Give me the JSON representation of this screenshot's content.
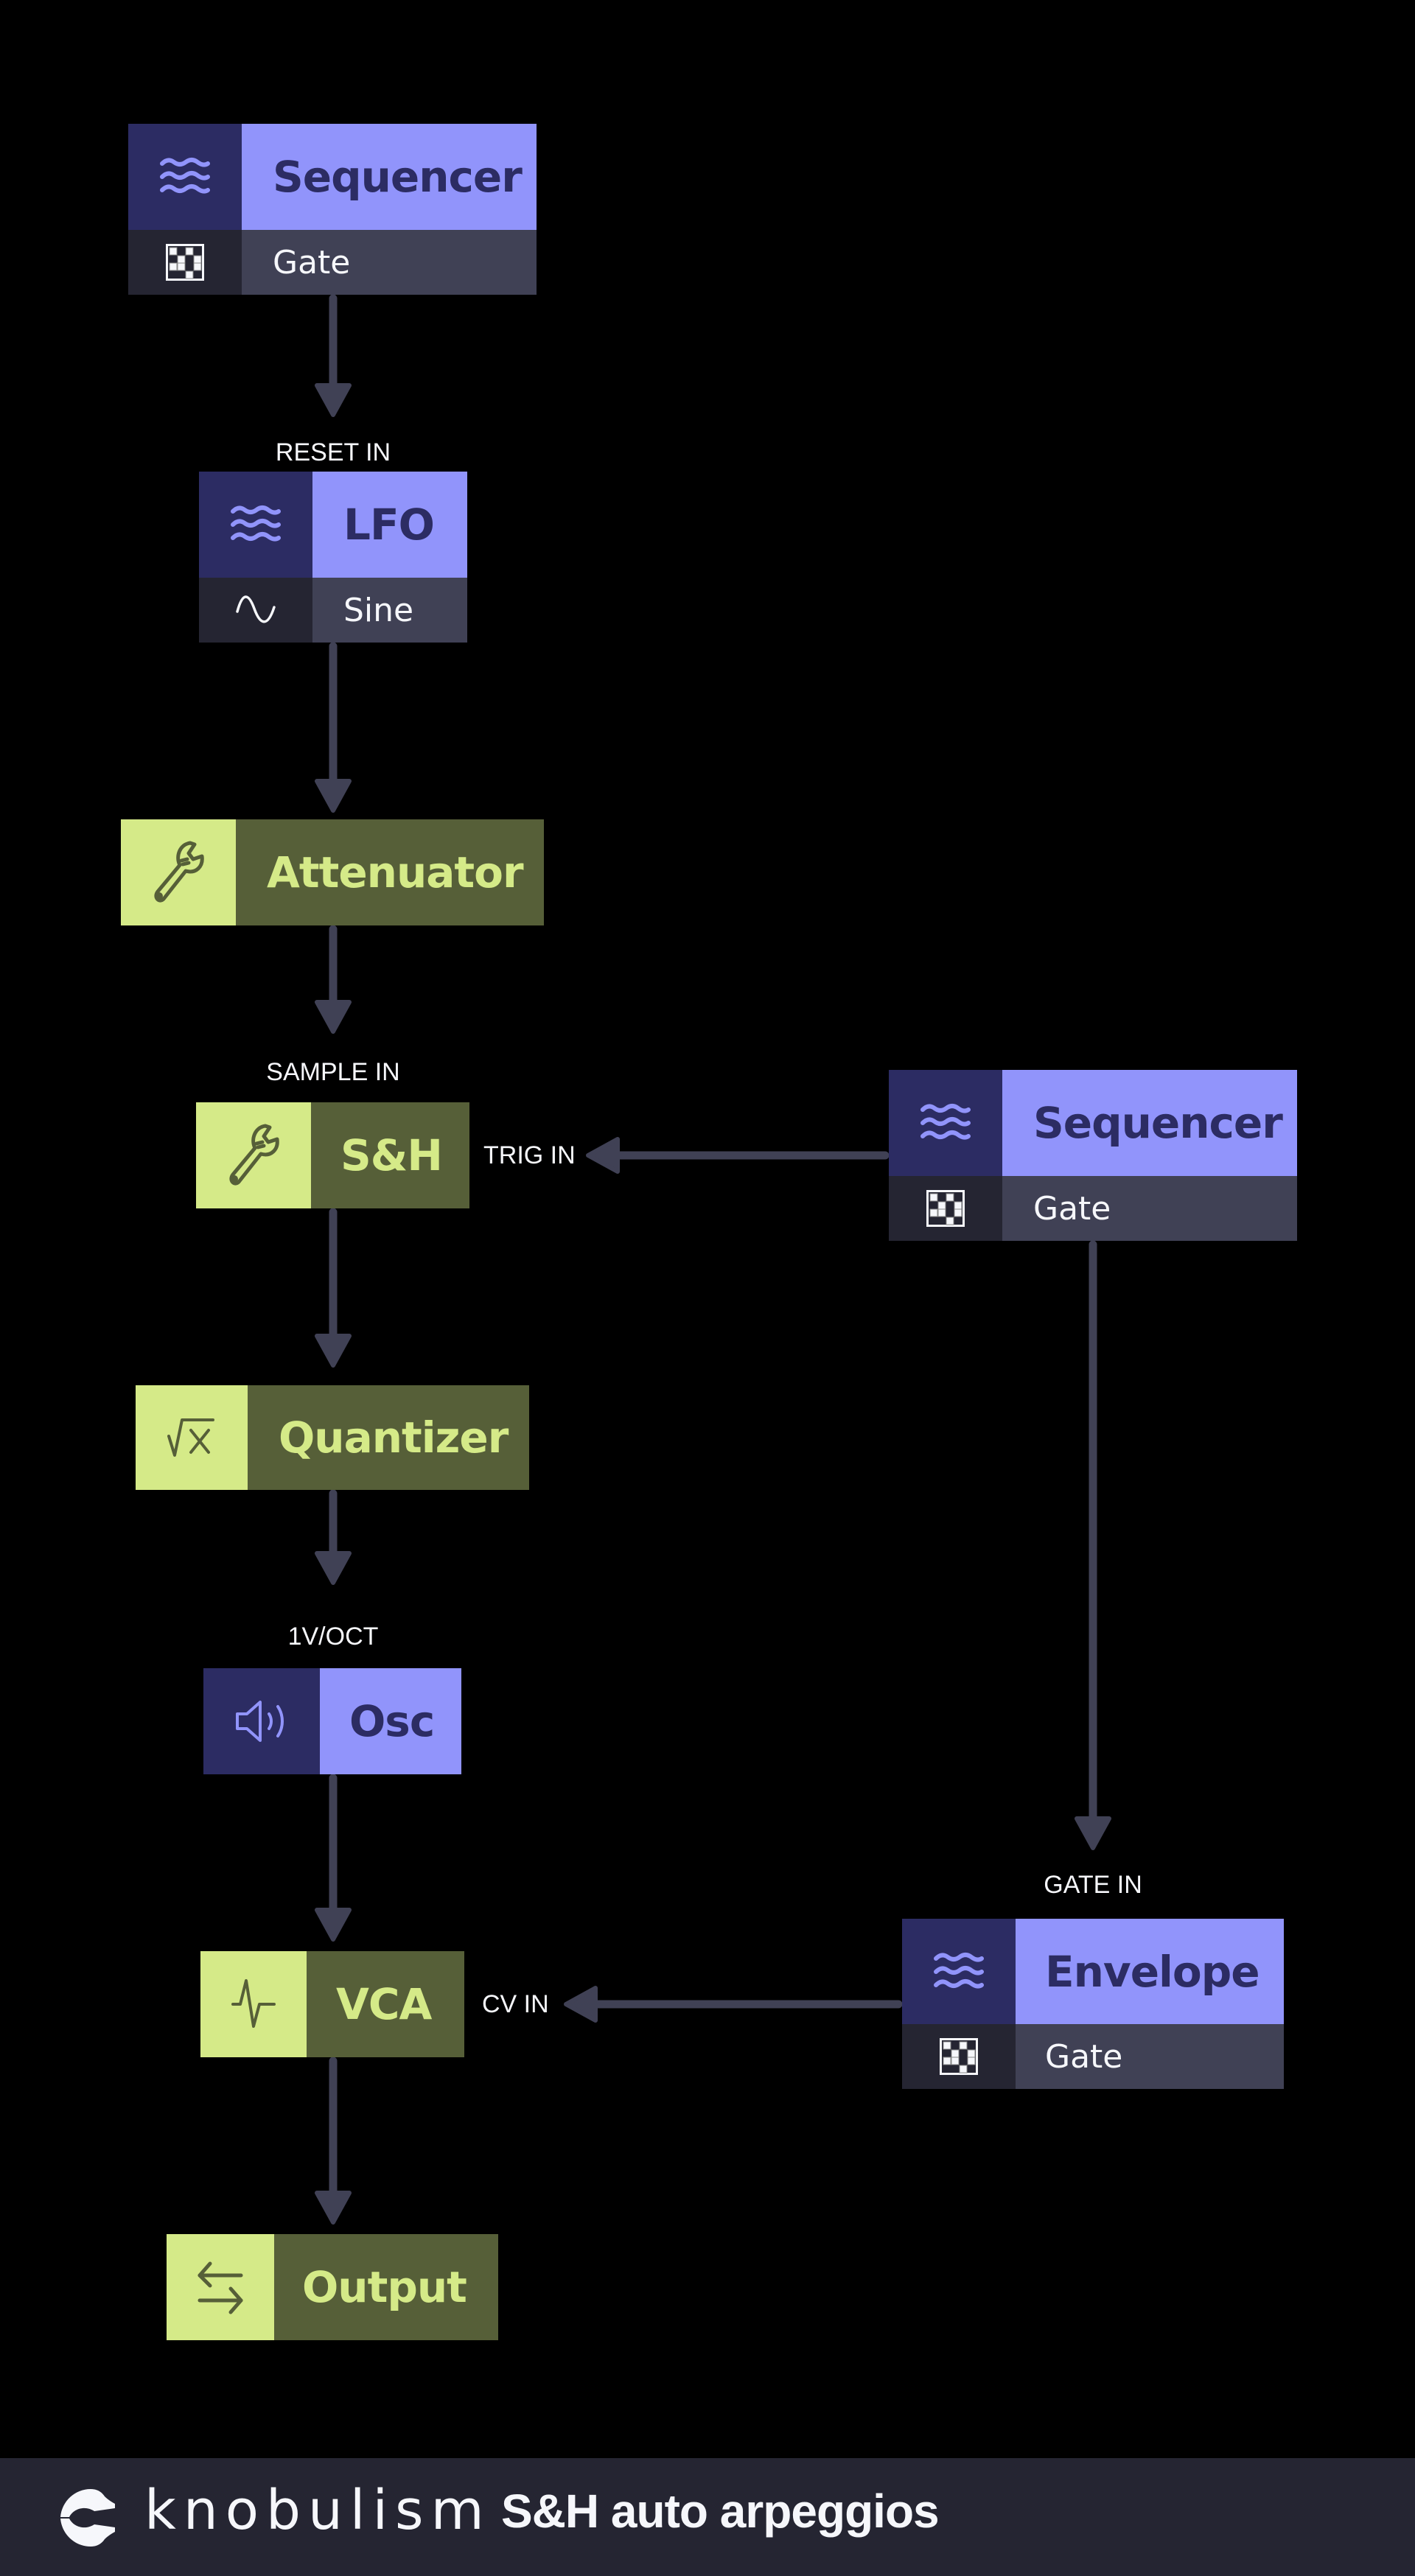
{
  "diagram": {
    "colors": {
      "background": "#000000",
      "wire": "#404155",
      "purple_light": "#9194fb",
      "purple_dark": "#2c2c63",
      "green_light": "#d5ea88",
      "green_dark": "#565f38",
      "sub_dark": "#252532",
      "sub_light": "#404155",
      "text_light": "#f6f7fb"
    },
    "nodes": {
      "sequencer_1": {
        "title": "Sequencer",
        "subtitle": "Gate",
        "icon": "waves-icon",
        "sub_icon": "gate-pattern-icon",
        "kind": "purple"
      },
      "lfo": {
        "title": "LFO",
        "subtitle": "Sine",
        "icon": "waves-icon",
        "sub_icon": "sine-wave-icon",
        "kind": "purple"
      },
      "attenuator": {
        "title": "Attenuator",
        "icon": "wrench-icon",
        "kind": "green"
      },
      "sample_hold": {
        "title": "S&H",
        "icon": "wrench-icon",
        "kind": "green"
      },
      "sequencer_2": {
        "title": "Sequencer",
        "subtitle": "Gate",
        "icon": "waves-icon",
        "sub_icon": "gate-pattern-icon",
        "kind": "purple"
      },
      "quantizer": {
        "title": "Quantizer",
        "icon": "square-root-icon",
        "kind": "green"
      },
      "osc": {
        "title": "Osc",
        "icon": "speaker-icon",
        "kind": "purple"
      },
      "vca": {
        "title": "VCA",
        "icon": "pulse-icon",
        "kind": "green"
      },
      "envelope": {
        "title": "Envelope",
        "subtitle": "Gate",
        "icon": "waves-icon",
        "sub_icon": "gate-pattern-icon",
        "kind": "purple"
      },
      "output": {
        "title": "Output",
        "icon": "swap-arrows-icon",
        "kind": "green"
      }
    },
    "ports": {
      "reset_in": "RESET IN",
      "sample_in": "SAMPLE IN",
      "trig_in": "TRIG IN",
      "gate_in": "GATE IN",
      "v_oct": "1V/OCT",
      "cv_in": "CV IN"
    },
    "connections": [
      {
        "from": "sequencer_1",
        "to": "lfo",
        "port": "RESET IN"
      },
      {
        "from": "lfo",
        "to": "attenuator",
        "port": ""
      },
      {
        "from": "attenuator",
        "to": "sample_hold",
        "port": "SAMPLE IN"
      },
      {
        "from": "sequencer_2",
        "to": "sample_hold",
        "port": "TRIG IN"
      },
      {
        "from": "sample_hold",
        "to": "quantizer",
        "port": ""
      },
      {
        "from": "quantizer",
        "to": "osc",
        "port": "1V/OCT"
      },
      {
        "from": "sequencer_2",
        "to": "envelope",
        "port": "GATE IN"
      },
      {
        "from": "osc",
        "to": "vca",
        "port": ""
      },
      {
        "from": "envelope",
        "to": "vca",
        "port": "CV IN"
      },
      {
        "from": "vca",
        "to": "output",
        "port": ""
      }
    ]
  },
  "footer": {
    "brand": "knobulism",
    "logo_icon": "knobulism-logo-icon",
    "title": "S&H auto arpeggios"
  }
}
